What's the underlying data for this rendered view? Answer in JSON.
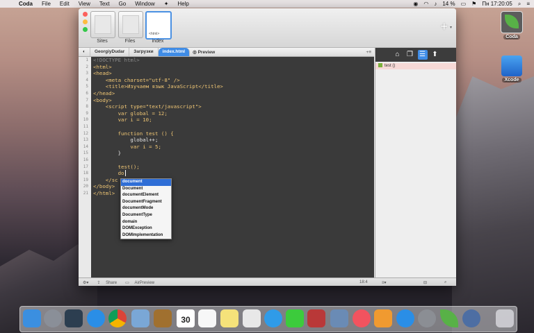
{
  "menubar": {
    "app": "Coda",
    "items": [
      "File",
      "Edit",
      "View",
      "Text",
      "Go",
      "Window",
      "Help"
    ],
    "status": {
      "battery": "14 %",
      "datetime": "Пн 17:20:05"
    }
  },
  "window": {
    "thumbnails": [
      {
        "label": "Sites"
      },
      {
        "label": "Files"
      },
      {
        "label": "index",
        "tag": "<html>"
      }
    ],
    "pathbar": {
      "crumbs": [
        "GeorgiyDudar",
        "Загрузки",
        "index.html"
      ],
      "preview": "Preview"
    },
    "gutter": [
      "1",
      "2",
      "3",
      "4",
      "5",
      "6",
      "7",
      "8",
      "9",
      "10",
      "11",
      "12",
      "13",
      "14",
      "15",
      "16",
      "17",
      "18",
      "19",
      "20",
      "21"
    ],
    "code": [
      "<!DOCTYPE html>",
      "<html>",
      "<head>",
      "    <meta charset=\"utf-8\" />",
      "    <title>Изучаем язык JavaScript</title>",
      "</head>",
      "<body>",
      "    <script type=\"text/javascript\">",
      "        var global = 12;",
      "        var i = 10;",
      "",
      "        function test () {",
      "            global++;",
      "            var i = 5;",
      "        }",
      "",
      "        test();",
      "        do",
      "    </sc",
      "</body>",
      "</html>"
    ],
    "autocomplete": [
      "document",
      "Document",
      "documentElement",
      "DocumentFragment",
      "documentMode",
      "DocumentType",
      "domain",
      "DOMException",
      "DOMImplementation"
    ],
    "sidebar": {
      "item": "test ()"
    },
    "statusbar": {
      "share": "Share",
      "airpreview": "AirPreview",
      "position": "18:4"
    }
  },
  "desktop": {
    "icons": [
      {
        "label": "Coda"
      },
      {
        "label": "Xcode"
      }
    ]
  },
  "dock": {
    "calendar_day": "30"
  }
}
